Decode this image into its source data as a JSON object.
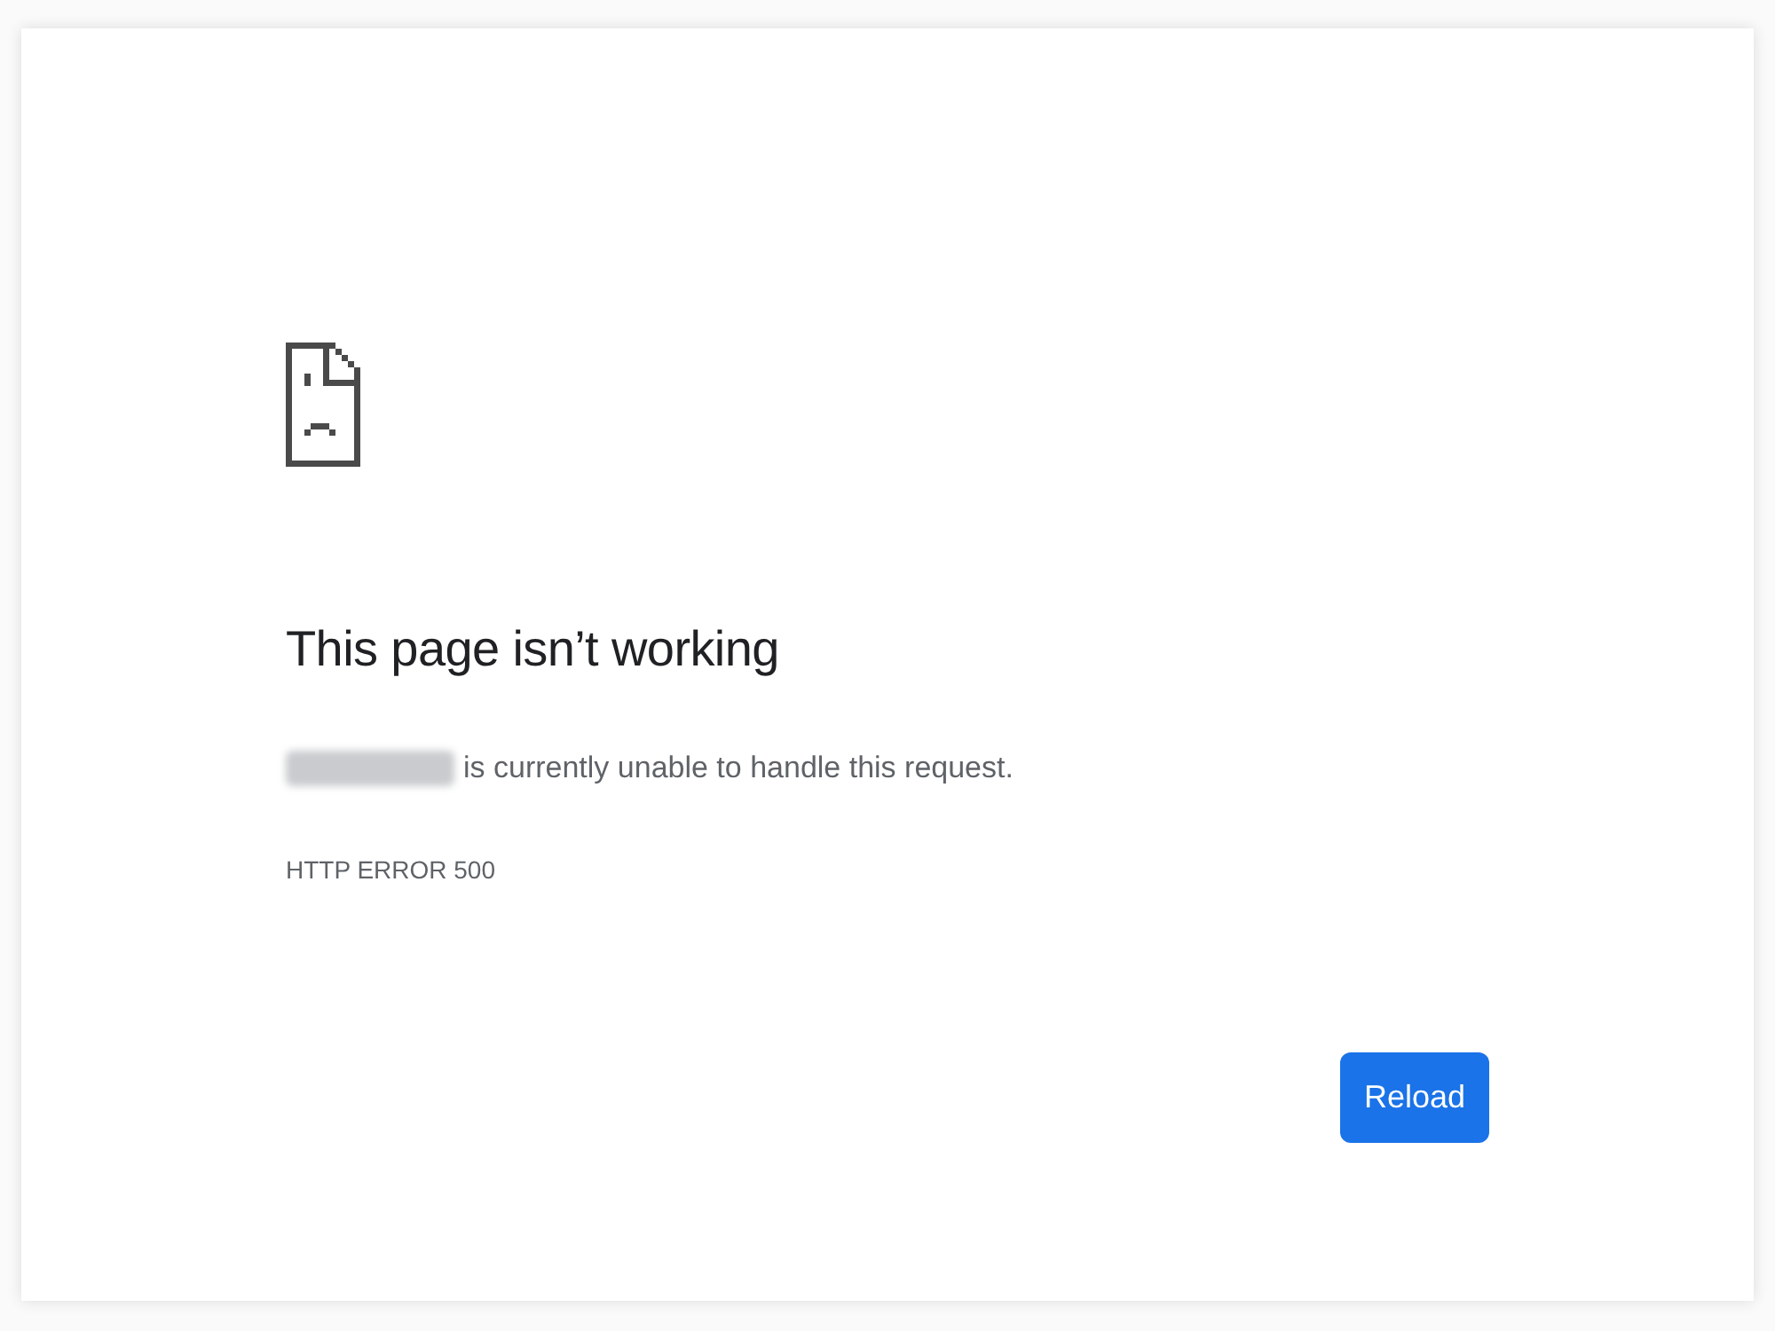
{
  "page": {
    "title": "This page isn’t working",
    "message": {
      "prefix_blurred": true,
      "text": "is currently unable to handle this request."
    },
    "error_code": "HTTP ERROR 500",
    "buttons": [
      {
        "label": "Reload",
        "kind": "primary"
      }
    ]
  }
}
